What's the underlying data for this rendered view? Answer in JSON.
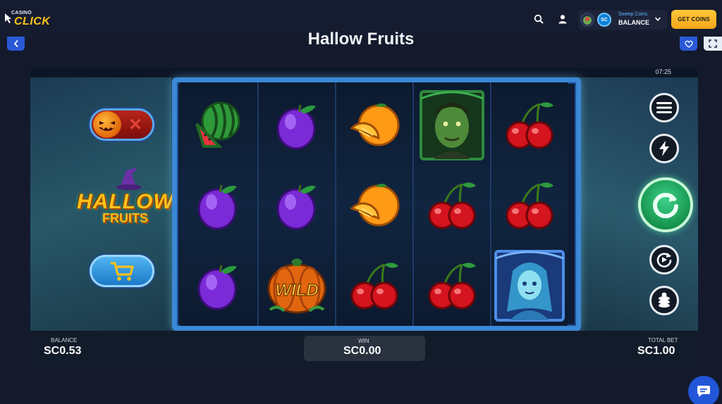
{
  "header": {
    "logo_small": "CASINO",
    "logo_big": "CLICK",
    "search_icon": "search-icon",
    "user_icon": "user-icon",
    "balance_label": "Sweep Coins",
    "balance_value": "BALANCE",
    "currency_badge": "SC",
    "get_coins_label": "GET COINS"
  },
  "subheader": {
    "title": "Hallow Fruits",
    "back_icon": "chevron-left-icon",
    "favorite_icon": "heart-icon",
    "fullscreen_icon": "fullscreen-icon"
  },
  "game": {
    "clock": "07:25",
    "logo_line1": "HALLOW",
    "logo_line2": "FRUITS",
    "reels": [
      [
        "watermelon",
        "plum",
        "plum"
      ],
      [
        "plum",
        "plum",
        "wild-pumpkin"
      ],
      [
        "orange",
        "orange",
        "cherry"
      ],
      [
        "zombie",
        "cherry",
        "cherry"
      ],
      [
        "cherry",
        "cherry",
        "ghost-girl"
      ]
    ],
    "wild_label": "WILD",
    "bottom": {
      "balance_label": "BALANCE",
      "balance_value": "SC0.53",
      "win_label": "WIN",
      "win_value": "SC0.00",
      "total_bet_label": "TOTAL BET",
      "total_bet_value": "SC1.00"
    },
    "colors": {
      "reel_border": "#3b88d6",
      "spin_button": "#16934d",
      "get_coins": "#ffc73a",
      "accent_blue": "#2a59d8"
    }
  }
}
